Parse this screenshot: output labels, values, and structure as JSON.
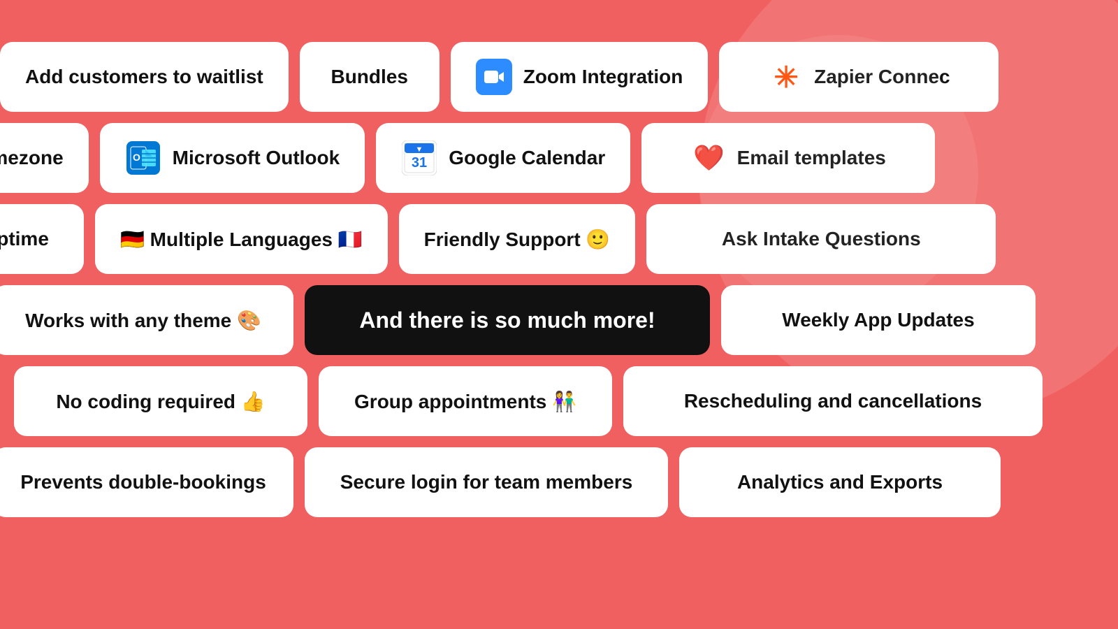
{
  "background_color": "#f06060",
  "rows": [
    {
      "id": "row1",
      "pills": [
        {
          "id": "add-waitlist",
          "text": "Add customers to waitlist",
          "icon": null,
          "dark": false,
          "overflow": "left"
        },
        {
          "id": "bundles",
          "text": "Bundles",
          "icon": null,
          "dark": false
        },
        {
          "id": "zoom",
          "text": "Zoom Integration",
          "icon": "zoom",
          "dark": false
        },
        {
          "id": "zapier",
          "text": "Zapier Connec…",
          "icon": "zapier",
          "dark": false,
          "overflow": "right"
        }
      ]
    },
    {
      "id": "row2",
      "pills": [
        {
          "id": "timezone",
          "text": "ock Timezone",
          "icon": null,
          "dark": false,
          "overflow": "left-clip"
        },
        {
          "id": "outlook",
          "text": "Microsoft Outlook",
          "icon": "outlook",
          "dark": false
        },
        {
          "id": "gcal",
          "text": "Google Calendar",
          "icon": "gcal",
          "dark": false
        },
        {
          "id": "email-templates",
          "text": "Email templates",
          "icon": "email",
          "dark": false,
          "overflow": "right"
        }
      ]
    },
    {
      "id": "row3",
      "pills": [
        {
          "id": "uptime",
          "text": "b Uptime",
          "icon": null,
          "dark": false,
          "overflow": "left-clip"
        },
        {
          "id": "languages",
          "text": "🇩🇪 Multiple Languages 🇫🇷",
          "icon": null,
          "dark": false
        },
        {
          "id": "support",
          "text": "Friendly Support 🙂",
          "icon": null,
          "dark": false
        },
        {
          "id": "intake",
          "text": "Ask Intake Questions",
          "icon": null,
          "dark": false,
          "overflow": "right"
        }
      ]
    },
    {
      "id": "row4",
      "pills": [
        {
          "id": "theme",
          "text": "Works with any theme 🎨",
          "icon": null,
          "dark": false,
          "overflow": "left"
        },
        {
          "id": "more",
          "text": "And there is so much more!",
          "icon": null,
          "dark": true
        },
        {
          "id": "weekly",
          "text": "Weekly App Updates",
          "icon": null,
          "dark": false,
          "overflow": "right"
        }
      ]
    },
    {
      "id": "row5",
      "pills": [
        {
          "id": "no-coding",
          "text": "No coding required 👍",
          "icon": null,
          "dark": false,
          "overflow": "left"
        },
        {
          "id": "group",
          "text": "Group appointments 👫",
          "icon": null,
          "dark": false
        },
        {
          "id": "rescheduling",
          "text": "Rescheduling and cancellations",
          "icon": null,
          "dark": false,
          "overflow": "right"
        }
      ]
    },
    {
      "id": "row6",
      "pills": [
        {
          "id": "double-bookings",
          "text": "Prevents double-bookings",
          "icon": null,
          "dark": false,
          "overflow": "left"
        },
        {
          "id": "secure-login",
          "text": "Secure login for team members",
          "icon": null,
          "dark": false
        },
        {
          "id": "analytics",
          "text": "Analytics and Exports",
          "icon": null,
          "dark": false,
          "overflow": "right"
        }
      ]
    }
  ]
}
